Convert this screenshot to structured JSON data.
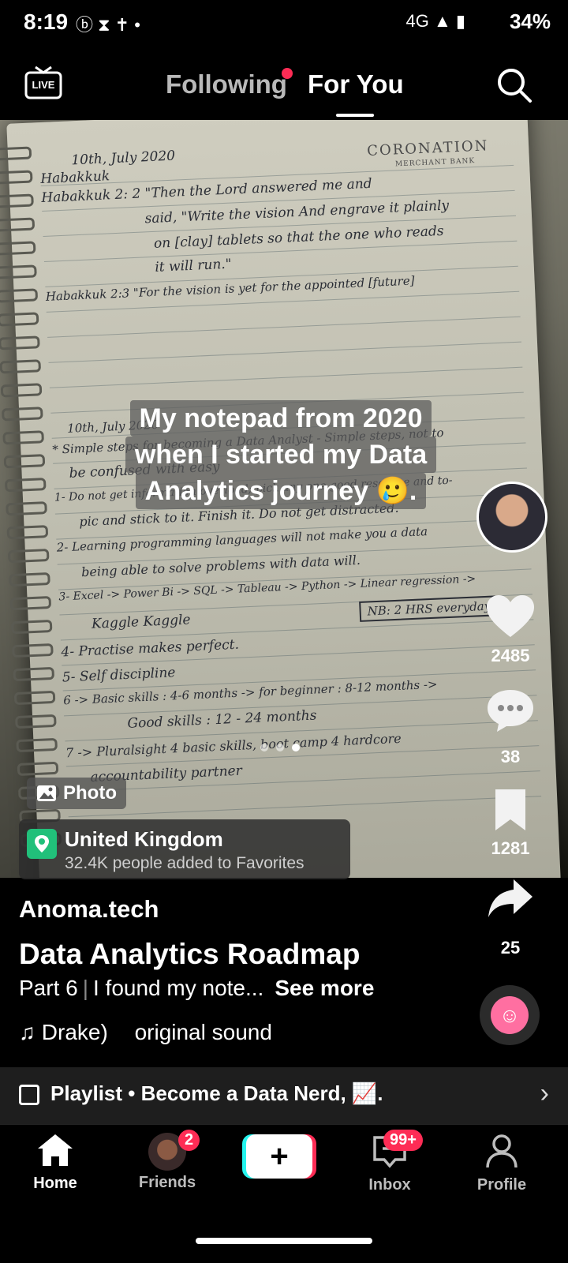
{
  "status_bar": {
    "time": "8:19",
    "battery": "34%",
    "network": "4G"
  },
  "top_nav": {
    "live_label": "LIVE",
    "tab_following": "Following",
    "tab_for_you": "For You"
  },
  "post": {
    "caption_overlay": [
      "My notepad from 2020",
      "when I started my Data",
      "Analytics journey 🥲."
    ],
    "media_type_badge": "Photo",
    "location_name": "United Kingdom",
    "location_sub": "32.4K people added to Favorites",
    "author": "Anoma.tech",
    "title": "Data Analytics Roadmap",
    "description_part": "Part 6",
    "description_text": "I found my note...",
    "see_more": "See more",
    "sound_artist": "Drake)",
    "sound_name": "original sound"
  },
  "notebook_text": [
    "10th, July 2020",
    "Habakkuk",
    "Habakkuk 2: 2 \"Then the Lord answered me and",
    "said, \"Write the vision And engrave it plainly",
    "on [clay] tablets so that the one who reads",
    "it will run.\"",
    "Habakkuk 2:3 \"For the vision is yet for the appointed [future]",
    "10th, July 2020",
    "* Simple steps for becoming a Data Analyst - Simple steps, not to",
    "be confused with easy",
    "1- Do not get information overload; pick any one good resource and to-",
    "pic and stick to it. Finish it. Do not get distracted.",
    "2- Learning programming languages will not make you a data",
    "being able to solve problems with data will.",
    "3- Excel -> Power Bi -> SQL -> Tableau -> Python -> Linear regression ->",
    "Kaggle Kaggle",
    "4- Practise makes perfect.",
    "5- Self discipline",
    "6 -> Basic skills : 4-6 months -> for beginner : 8-12 months ->",
    "Good skills : 12 - 24 months",
    "7 -> Pluralsight 4 basic skills, boot camp 4 hardcore",
    "accountability partner",
    "NB: 2 HRS everyday",
    "CORONATION",
    "MERCHANT BANK"
  ],
  "actions": {
    "likes": "2485",
    "comments": "38",
    "saves": "1281",
    "shares": "25"
  },
  "playlist": {
    "label": "Playlist • Become a Data Nerd, 📈."
  },
  "bottom_nav": {
    "home": "Home",
    "friends": "Friends",
    "friends_badge": "2",
    "inbox": "Inbox",
    "inbox_badge": "99+",
    "profile": "Profile"
  },
  "colors": {
    "accent_red": "#fe2c55",
    "accent_cyan": "#25f4ee",
    "location_pin": "#21c07a"
  },
  "icons": [
    "live-icon",
    "search-icon",
    "heart-icon",
    "comment-icon",
    "bookmark-icon",
    "share-icon",
    "music-note-icon",
    "playlist-icon",
    "chevron-right-icon",
    "home-icon",
    "inbox-icon",
    "profile-icon",
    "plus-icon",
    "photo-icon",
    "location-pin-icon"
  ]
}
